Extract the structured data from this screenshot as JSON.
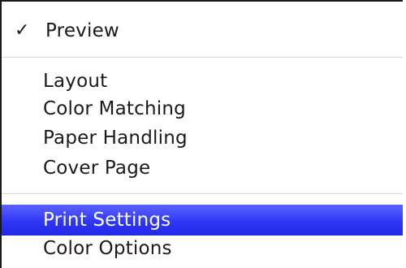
{
  "menu": {
    "checked_item": {
      "check_glyph": "✓",
      "label": "Preview"
    },
    "group_1": [
      {
        "label": "Layout"
      },
      {
        "label": "Color Matching"
      },
      {
        "label": "Paper Handling"
      },
      {
        "label": "Cover Page"
      }
    ],
    "group_2": [
      {
        "label": "Print Settings",
        "highlighted": true
      },
      {
        "label": "Color Options",
        "highlighted": false
      }
    ]
  },
  "colors": {
    "highlight": "#2f37f5",
    "text": "#1a1a1a",
    "highlight_text": "#ffffff",
    "separator": "#d6d6d6"
  }
}
